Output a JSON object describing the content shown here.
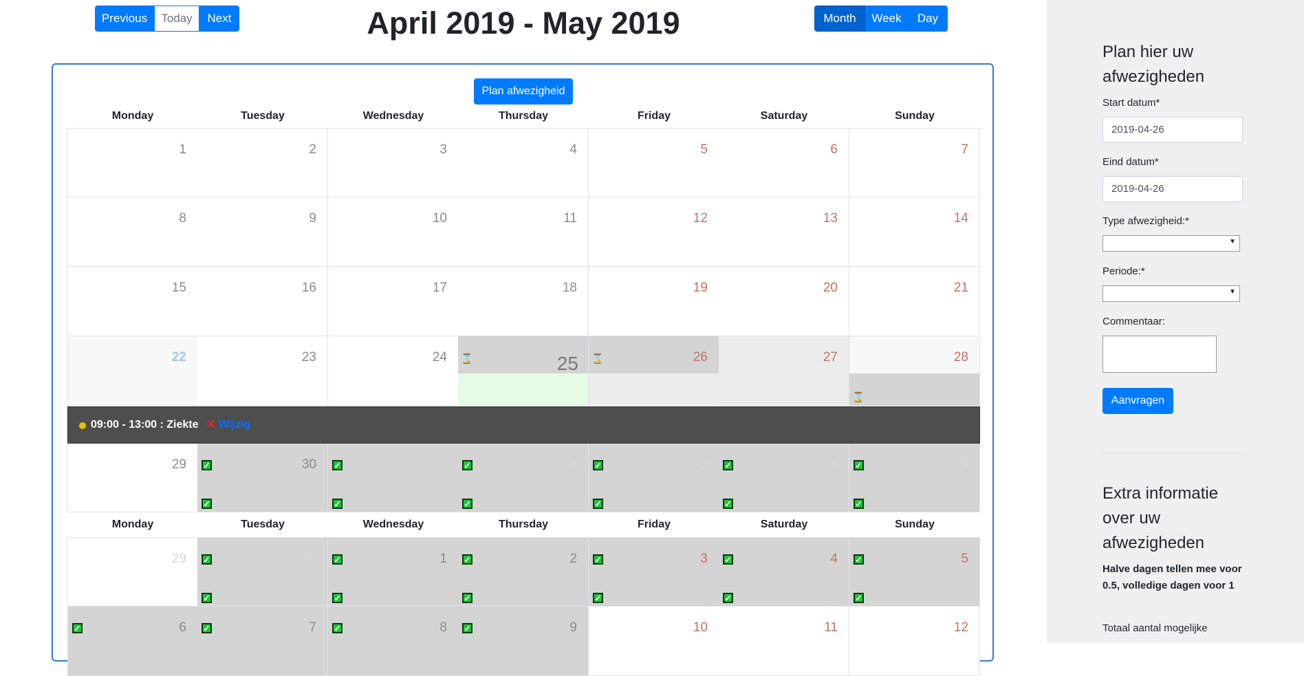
{
  "nav": {
    "previous": "Previous",
    "today": "Today",
    "next": "Next"
  },
  "title": "April 2019 - May 2019",
  "views": {
    "month": "Month",
    "week": "Week",
    "day": "Day"
  },
  "plan_button": "Plan afwezigheid",
  "weekdays": [
    "Monday",
    "Tuesday",
    "Wednesday",
    "Thursday",
    "Friday",
    "Saturday",
    "Sunday"
  ],
  "weeks": [
    [
      "1",
      "2",
      "3",
      "4",
      "5",
      "6",
      "7"
    ],
    [
      "8",
      "9",
      "10",
      "11",
      "12",
      "13",
      "14"
    ],
    [
      "15",
      "16",
      "17",
      "18",
      "19",
      "20",
      "21"
    ],
    [
      "22",
      "23",
      "24",
      "25",
      "26",
      "27",
      "28"
    ],
    [
      "29",
      "30",
      "1",
      "2",
      "3",
      "4",
      "5"
    ],
    [
      "29",
      "30",
      "1",
      "2",
      "3",
      "4",
      "5"
    ],
    [
      "6",
      "7",
      "8",
      "9",
      "10",
      "11",
      "12"
    ]
  ],
  "event": {
    "time": "09:00 - 13:00 : Ziekte",
    "edit_label": "Wijzig",
    "status_color": "#e6c000"
  },
  "form": {
    "heading": "Plan hier uw afwezigheden",
    "start_label": "Start datum*",
    "start_value": "2019-04-26",
    "end_label": "Eind datum*",
    "end_value": "2019-04-26",
    "type_label": "Type afwezigheid:*",
    "period_label": "Periode:*",
    "comment_label": "Commentaar:",
    "submit": "Aanvragen"
  },
  "info": {
    "heading": "Extra informatie over uw afwezigheden",
    "bold_text": "Halve dagen tellen mee voor 0.5, volledige dagen voor 1",
    "total_text": "Totaal aantal mogelijke"
  },
  "colors": {
    "primary": "#007bff",
    "weekend_text": "#c0706f",
    "today_text": "#a9c4ee"
  }
}
